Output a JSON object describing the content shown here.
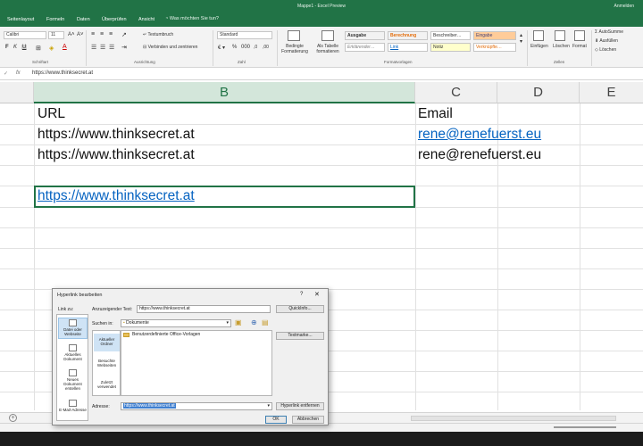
{
  "window": {
    "title": "Mappe1 - Excel Preview",
    "signin": "Anmelden"
  },
  "ribbon_tabs": [
    "Seitenlayout",
    "Formeln",
    "Daten",
    "Überprüfen",
    "Ansicht"
  ],
  "tell_me": "Was möchten Sie tun?",
  "ribbon": {
    "font_name": "Calibri",
    "font_size": "11",
    "wrap_text": "Textumbruch",
    "merge_center": "Verbinden und zentrieren",
    "number_format": "Standard",
    "conditional_formatting": "Bedingte Formatierung",
    "format_as_table": "Als Tabelle formatieren",
    "styles": [
      "Ausgabe",
      "Berechnung",
      "Beschreiber…",
      "Eingabe",
      "Erklärender…",
      "Link",
      "Notiz",
      "Verknüpfte…"
    ],
    "insert": "Einfügen",
    "delete": "Löschen",
    "format": "Format",
    "autosum": "AutoSumme",
    "fill": "Ausfüllen",
    "clear": "Löschen",
    "groups": [
      "Schriftart",
      "Ausrichtung",
      "Zahl",
      "Formatvorlagen",
      "Zellen"
    ],
    "colors": {
      "ausgabe": "#f2f2f2",
      "berechnung": "#f2f2f2",
      "eingabe": "#ffcc99",
      "notiz": "#ffffcc"
    }
  },
  "formula_bar": {
    "fx": "fx",
    "value": "https://www.thinksecret.at"
  },
  "grid": {
    "columns": [
      "B",
      "C",
      "D",
      "E"
    ],
    "selected_column": "B",
    "rows": [
      {
        "b": "URL",
        "c": "Email"
      },
      {
        "b": "https://www.thinksecret.at",
        "c": "rene@renefuerst.eu"
      },
      {
        "b": "https://www.thinksecret.at",
        "c": "rene@renefuerst.eu"
      },
      {
        "b": "https://www.thinksecret.at",
        "c": ""
      }
    ]
  },
  "dialog": {
    "title": "Hyperlink bearbeiten",
    "help": "?",
    "close": "✕",
    "link_to_label": "Link zu:",
    "display_text_label": "Anzuzeigender Text:",
    "display_text_value": "https://www.thinksecret.at",
    "quickinfo_button": "QuickInfo...",
    "look_in_label": "Suchen in:",
    "look_in_value": "Dokumente",
    "link_to_items": [
      "Datei oder Webseite",
      "Aktuelles Dokument",
      "Neues Dokument erstellen",
      "E-Mail-Adresse"
    ],
    "places": [
      "Aktueller Ordner",
      "Besuchte Webseiten",
      "Zuletzt verwendet"
    ],
    "files": [
      "Benutzerdefinierte Office-Vorlagen"
    ],
    "bookmark_button": "Textmarke...",
    "address_label": "Adresse:",
    "address_value": "https://www.thinksecret.at",
    "remove_link_button": "Hyperlink entfernen",
    "ok_button": "OK",
    "cancel_button": "Abbrechen"
  }
}
